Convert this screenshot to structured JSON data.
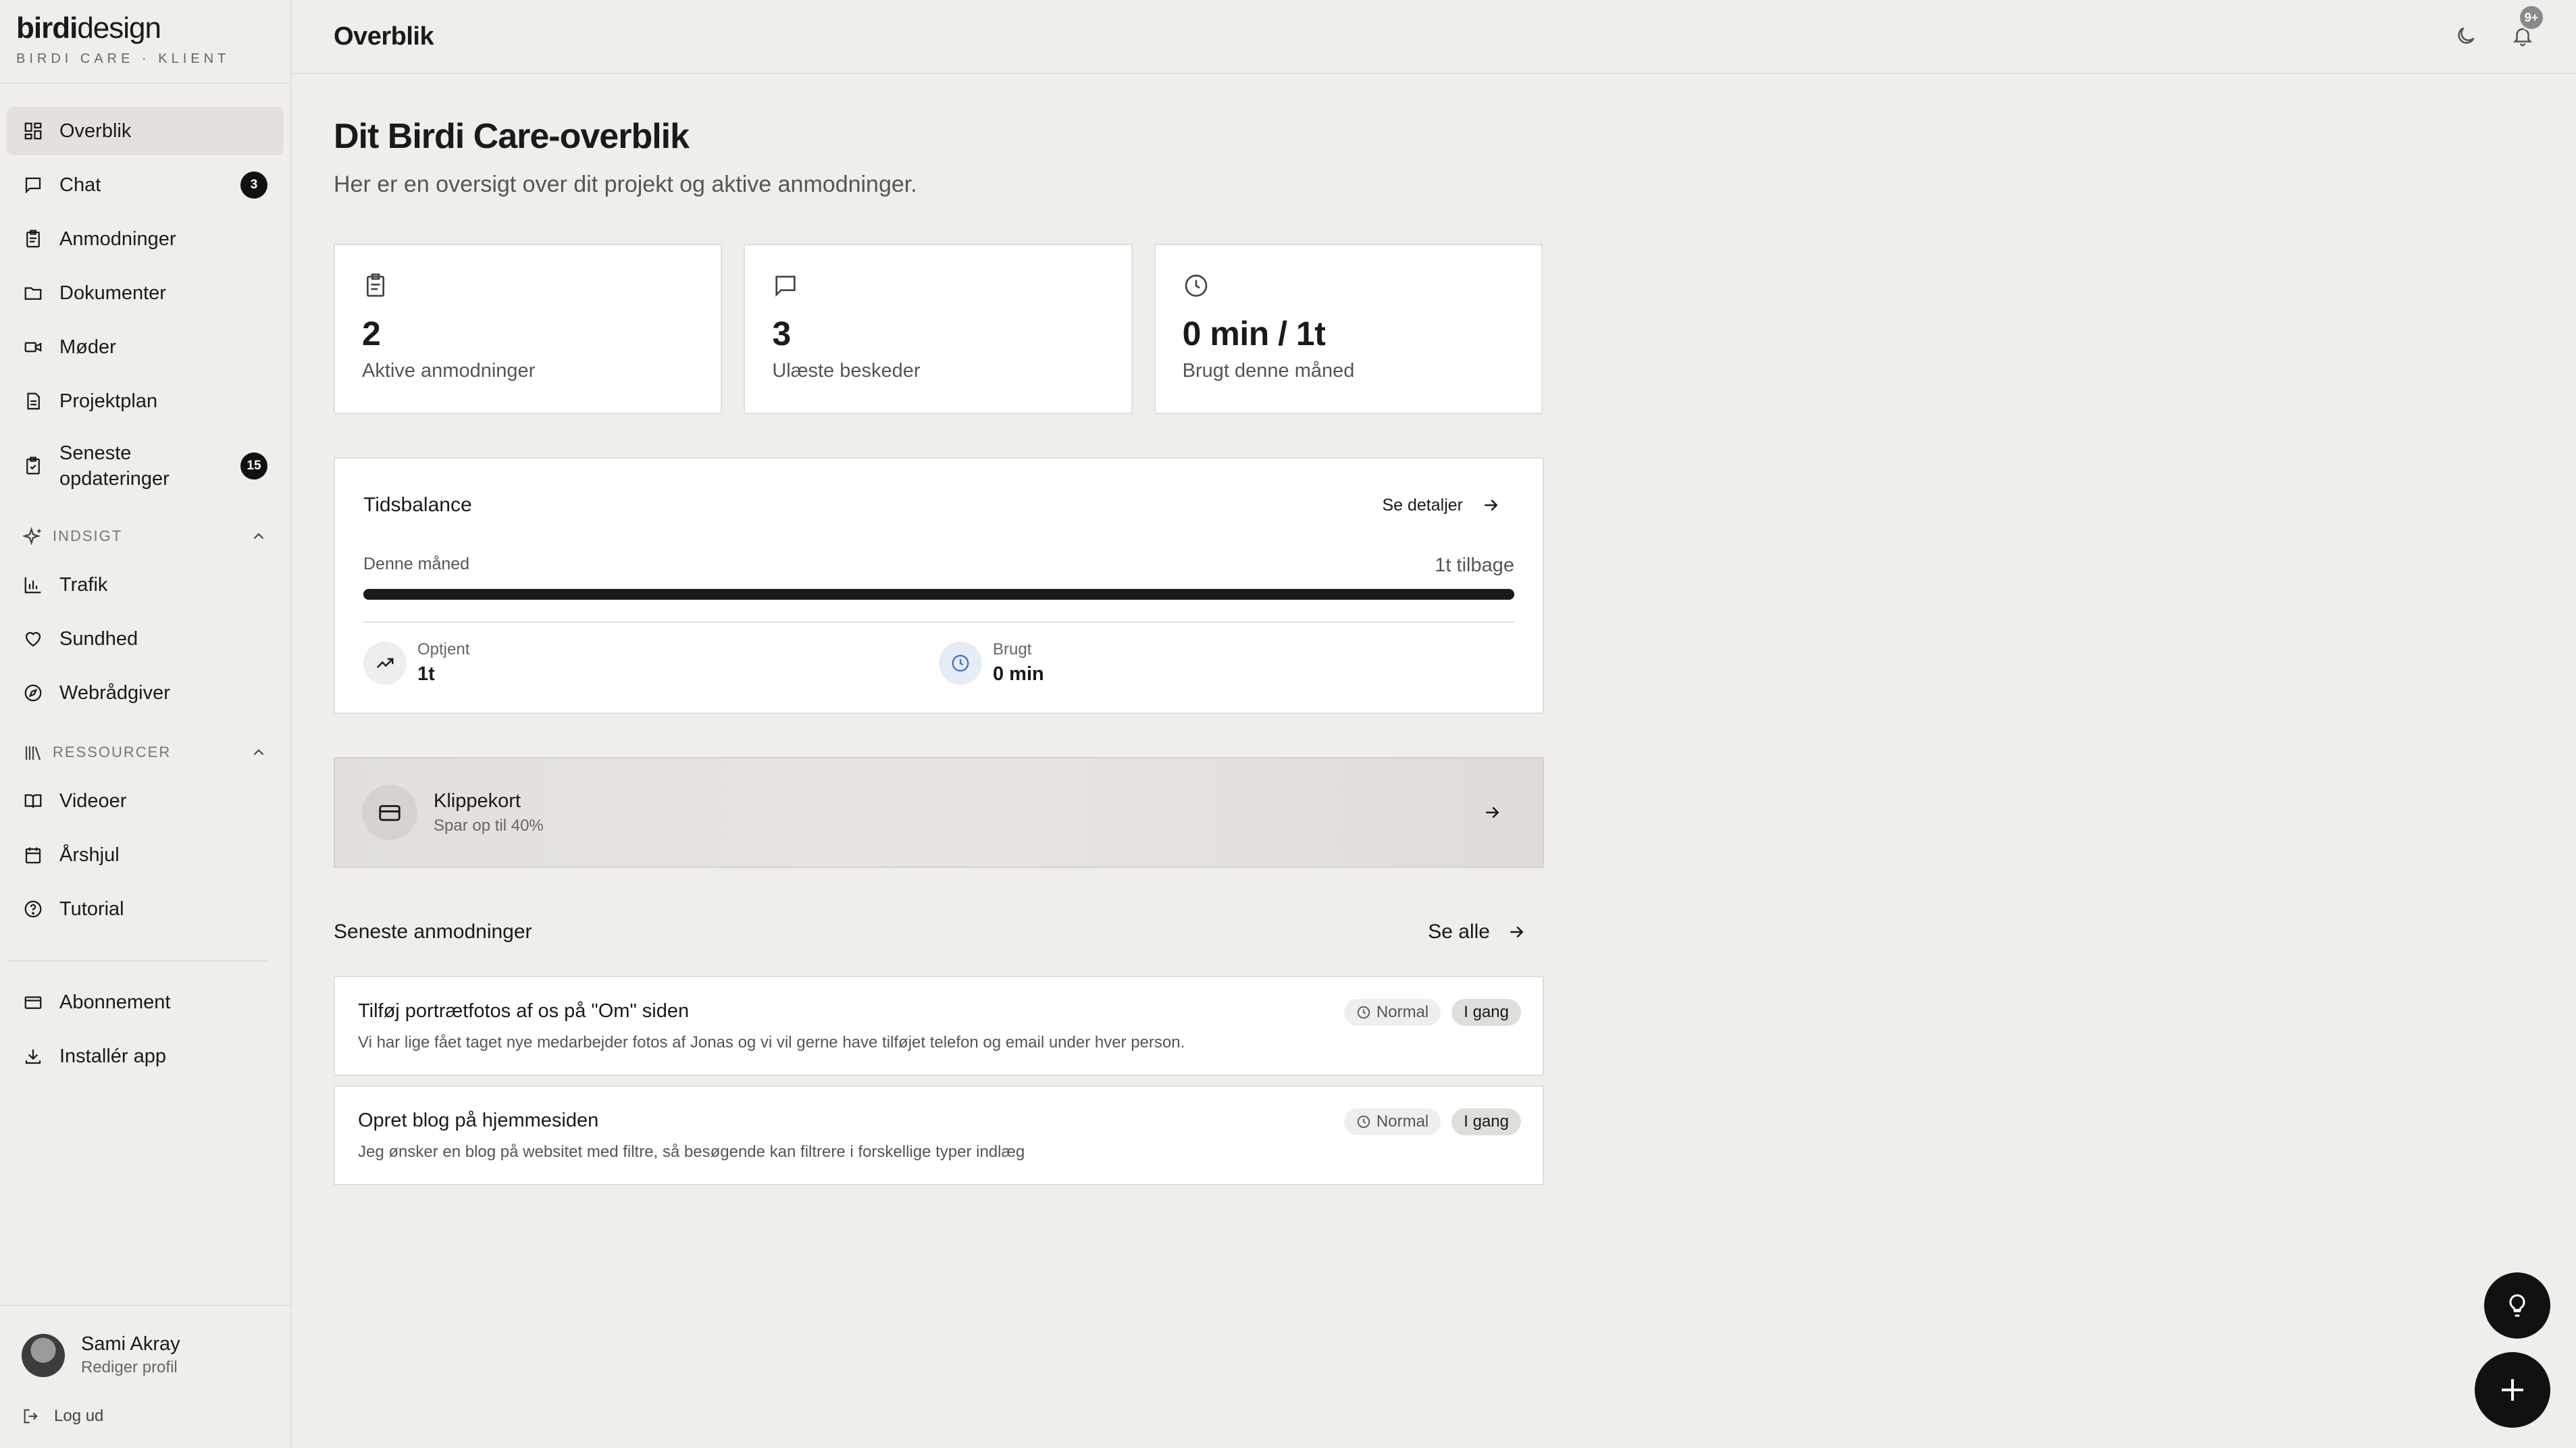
{
  "brand": {
    "logo_bold": "birdi",
    "logo_light": "design",
    "subtitle": "BIRDI CARE · KLIENT"
  },
  "sidebar": {
    "items": [
      {
        "label": "Overblik",
        "icon": "dashboard-icon",
        "active": true
      },
      {
        "label": "Chat",
        "icon": "chat-icon",
        "badge": "3"
      },
      {
        "label": "Anmodninger",
        "icon": "clipboard-icon"
      },
      {
        "label": "Dokumenter",
        "icon": "folder-icon"
      },
      {
        "label": "Møder",
        "icon": "video-icon"
      },
      {
        "label": "Projektplan",
        "icon": "document-icon"
      },
      {
        "label": "Seneste opdateringer",
        "label_line1": "Seneste",
        "label_line2": "opdateringer",
        "icon": "clipboard-check-icon",
        "badge": "15"
      }
    ],
    "sections": [
      {
        "title": "INDSIGT",
        "icon": "sparkles-icon",
        "items": [
          {
            "label": "Trafik",
            "icon": "bar-chart-icon"
          },
          {
            "label": "Sundhed",
            "icon": "heart-icon"
          },
          {
            "label": "Webrådgiver",
            "icon": "compass-icon"
          }
        ]
      },
      {
        "title": "RESSOURCER",
        "icon": "library-icon",
        "items": [
          {
            "label": "Videoer",
            "icon": "book-icon"
          },
          {
            "label": "Årshjul",
            "icon": "calendar-icon"
          },
          {
            "label": "Tutorial",
            "icon": "help-circle-icon"
          }
        ]
      }
    ],
    "bottom_items": [
      {
        "label": "Abonnement",
        "icon": "credit-card-icon"
      },
      {
        "label": "Installér app",
        "icon": "download-icon"
      }
    ],
    "profile": {
      "name": "Sami Akray",
      "edit_label": "Rediger profil",
      "logout_label": "Log ud"
    }
  },
  "header": {
    "title": "Overblik",
    "notification_badge": "9+"
  },
  "main": {
    "title": "Dit Birdi Care-overblik",
    "subtitle": "Her er en oversigt over dit projekt og aktive anmodninger.",
    "stats": [
      {
        "value": "2",
        "label": "Aktive anmodninger",
        "icon": "clipboard-icon"
      },
      {
        "value": "3",
        "label": "Ulæste beskeder",
        "icon": "chat-icon"
      },
      {
        "value": "0 min / 1t",
        "label": "Brugt denne måned",
        "icon": "clock-icon"
      }
    ],
    "time_balance": {
      "title": "Tidsbalance",
      "link_label": "Se detaljer",
      "period_label": "Denne måned",
      "remaining_label": "1t tilbage",
      "progress_fraction": 1.0,
      "earned_label": "Optjent",
      "earned_value": "1t",
      "used_label": "Brugt",
      "used_value": "0 min"
    },
    "punch_card": {
      "title": "Klippekort",
      "subtitle": "Spar op til 40%"
    },
    "requests": {
      "title": "Seneste anmodninger",
      "see_all_label": "Se alle",
      "items": [
        {
          "title": "Tilføj portrætfotos af os på \"Om\" siden",
          "description": "Vi har lige fået taget nye medarbejder fotos af Jonas og vi vil gerne have tilføjet telefon og email under hver person.",
          "priority": "Normal",
          "status": "I gang"
        },
        {
          "title": "Opret blog på hjemmesiden",
          "description": "Jeg ønsker en blog på websitet med filtre, så besøgende kan filtrere i forskellige typer indlæg",
          "priority": "Normal",
          "status": "I gang"
        }
      ]
    }
  },
  "colors": {
    "background": "#f0eeeb",
    "card": "#ffffff",
    "accent": "#111111",
    "border": "#e2dfdb"
  }
}
